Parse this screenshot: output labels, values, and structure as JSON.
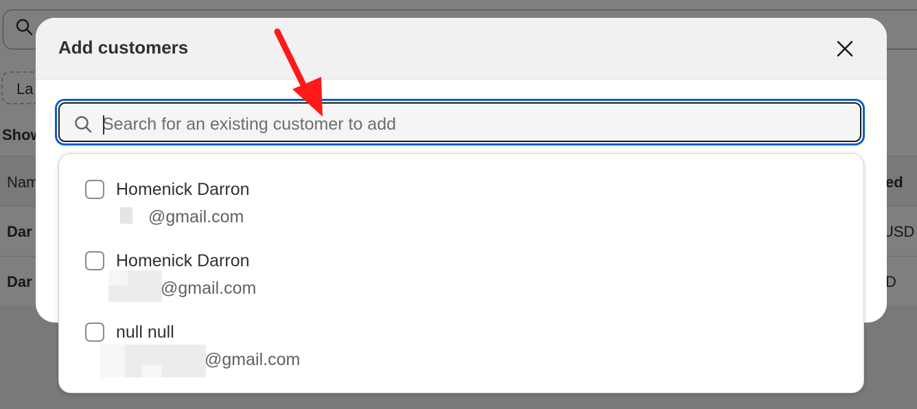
{
  "background": {
    "chip_label": "La",
    "show_label": "Show",
    "column_left": "Nam",
    "column_right": "ed",
    "row1_left": "Dar",
    "row1_right": "USD",
    "row2_left": "Dar",
    "row2_right": "D"
  },
  "modal": {
    "title": "Add customers",
    "close_icon": "close-icon"
  },
  "search": {
    "placeholder": "Search for an existing customer to add",
    "value": "",
    "icon": "search-icon"
  },
  "results": [
    {
      "name": "Homenick Darron",
      "email_visible": "@gmail.com",
      "checked": false
    },
    {
      "name": "Homenick Darron",
      "email_visible": "@gmail.com",
      "checked": false
    },
    {
      "name": "null null",
      "email_visible": "@gmail.com",
      "checked": false
    }
  ],
  "colors": {
    "focus_ring": "#0b5bd3",
    "annotation_arrow": "#ff1a1a"
  }
}
